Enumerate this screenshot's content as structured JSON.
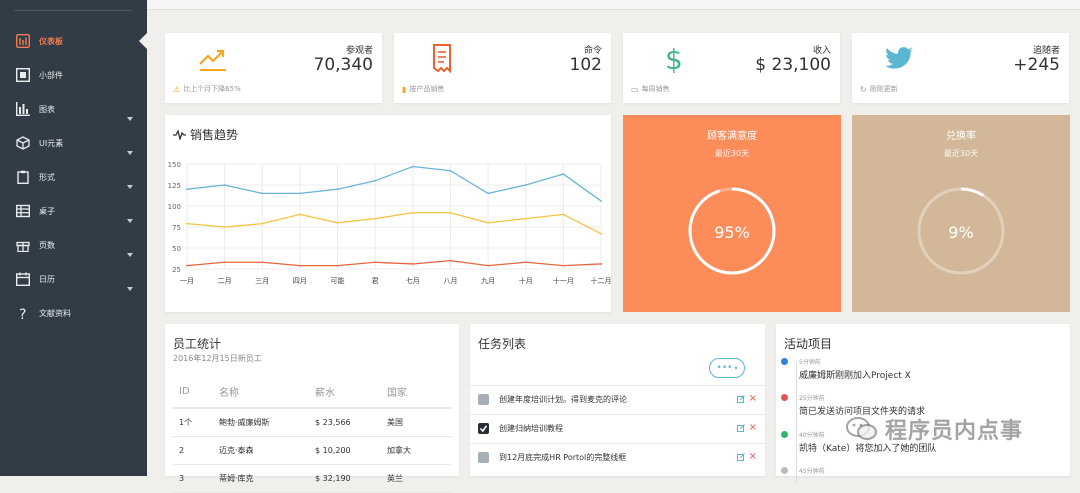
{
  "sidebar": {
    "items": [
      {
        "label": "仪表板",
        "icon": "dashboard-icon",
        "active": true,
        "has_chevron": false
      },
      {
        "label": "小部件",
        "icon": "widget-icon",
        "active": false,
        "has_chevron": false
      },
      {
        "label": "图表",
        "icon": "bar-chart-icon",
        "active": false,
        "has_chevron": true
      },
      {
        "label": "UI元素",
        "icon": "cube-icon",
        "active": false,
        "has_chevron": true
      },
      {
        "label": "形式",
        "icon": "clipboard-icon",
        "active": false,
        "has_chevron": true
      },
      {
        "label": "桌子",
        "icon": "table-icon",
        "active": false,
        "has_chevron": true
      },
      {
        "label": "页数",
        "icon": "gift-icon",
        "active": false,
        "has_chevron": true
      },
      {
        "label": "日历",
        "icon": "calendar-icon",
        "active": false,
        "has_chevron": true
      },
      {
        "label": "文献资料",
        "icon": "question-icon",
        "active": false,
        "has_chevron": false
      }
    ]
  },
  "stats": [
    {
      "label": "参观者",
      "value": "70,340",
      "footer": "比上个月下降65%",
      "icon": "trend-up-icon",
      "footer_icon": "warning-icon",
      "color": "#f6a623"
    },
    {
      "label": "命令",
      "value": "102",
      "footer": "按产品销售",
      "icon": "receipt-icon",
      "footer_icon": "trash-icon",
      "color": "#e8632e"
    },
    {
      "label": "收入",
      "value": "$ 23,100",
      "footer": "每周销售",
      "icon": "dollar-icon",
      "footer_icon": "calendar-icon",
      "color": "#3fb68b"
    },
    {
      "label": "追随者",
      "value": "+245",
      "footer": "刚刚更新",
      "icon": "twitter-icon",
      "footer_icon": "refresh-icon",
      "color": "#5bb6d2"
    }
  ],
  "sales": {
    "title": "销售趋势"
  },
  "chart_data": {
    "type": "line",
    "categories": [
      "一月",
      "二月",
      "三月",
      "四月",
      "可能",
      "君",
      "七月",
      "八月",
      "九月",
      "十月",
      "十一月",
      "十二月"
    ],
    "ylim": [
      25,
      150
    ],
    "yticks": [
      25,
      50,
      75,
      100,
      125,
      150
    ],
    "grid": true,
    "series": [
      {
        "color": "#6ab4d8",
        "values": [
          120,
          125,
          115,
          115,
          120,
          130,
          147,
          142,
          115,
          125,
          138,
          106
        ]
      },
      {
        "color": "#f5c342",
        "values": [
          79,
          75,
          79,
          90,
          80,
          85,
          92,
          92,
          80,
          85,
          90,
          67
        ]
      },
      {
        "color": "#e9663f",
        "values": [
          29,
          33,
          33,
          29,
          29,
          33,
          31,
          35,
          29,
          33,
          29,
          31
        ]
      }
    ]
  },
  "satisfaction": {
    "title": "顾客满意度",
    "subtitle": "最近30天",
    "percent": "95%",
    "fraction": 0.95,
    "bg": "#fd8c5b"
  },
  "conversion": {
    "title": "兑换率",
    "subtitle": "最近30天",
    "percent": "9%",
    "fraction": 0.09,
    "bg": "#d2b899"
  },
  "employees": {
    "title": "员工统计",
    "subtitle": "2016年12月15日新员工",
    "headers": [
      "ID",
      "名称",
      "薪水",
      "国家"
    ],
    "rows": [
      [
        "1个",
        "鲍勃·威廉姆斯",
        "$ 23,566",
        "美国"
      ],
      [
        "2",
        "迈克·泰森",
        "$ 10,200",
        "加拿大"
      ],
      [
        "3",
        "蒂姆·库克",
        "$ 32,190",
        "英兰"
      ]
    ]
  },
  "tasks": {
    "title": "任务列表",
    "menu_label": "•••",
    "items": [
      {
        "text": "创建年度培训计划。得到麦克的评论",
        "checked": false
      },
      {
        "text": "创建归纳培训教程",
        "checked": true
      },
      {
        "text": "到12月底完成HR Portol的完整线框",
        "checked": false
      }
    ]
  },
  "activity": {
    "title": "活动项目",
    "items": [
      {
        "time": "5分钟前",
        "text": "威廉姆斯刚刚加入Project X",
        "color": "#2b84d8"
      },
      {
        "time": "25分钟前",
        "text": "简已发送访问项目文件夹的请求",
        "color": "#e25555"
      },
      {
        "time": "40分钟前",
        "text": "凯特（Kate）将您加入了她的团队",
        "color": "#2fb56a"
      },
      {
        "time": "45分钟前",
        "text": "",
        "color": "#bbbbbb"
      }
    ]
  },
  "watermark": {
    "text": "程序员内点事"
  }
}
